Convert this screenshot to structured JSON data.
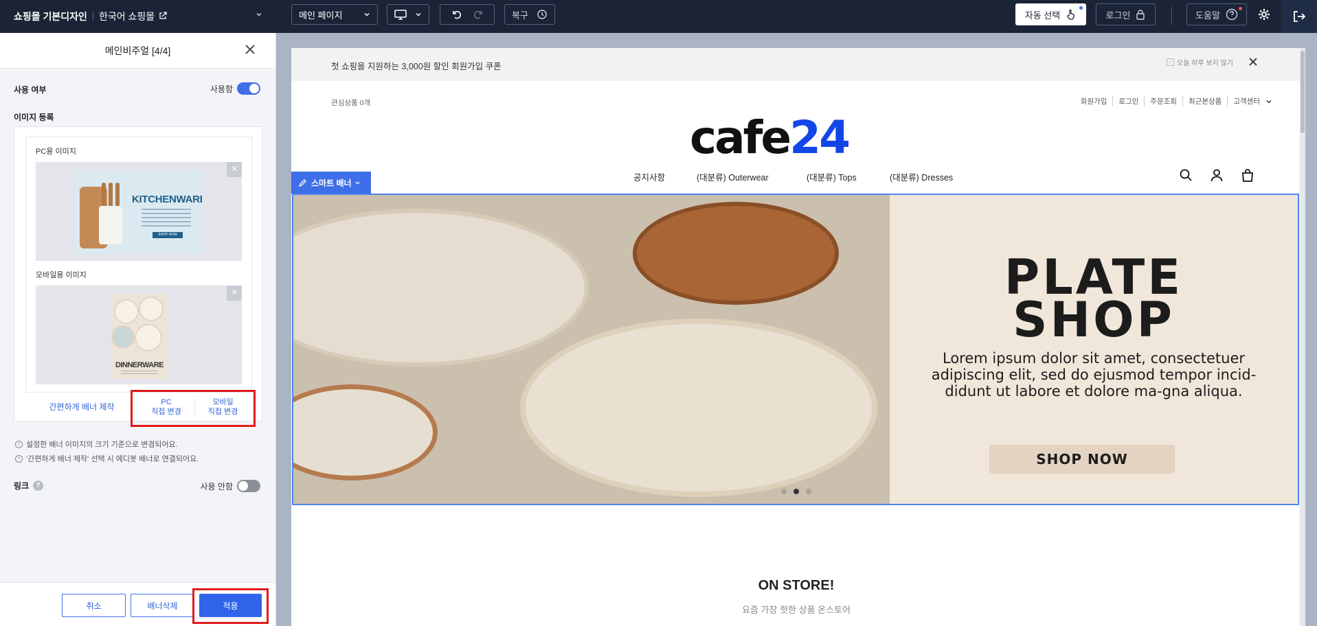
{
  "topbar": {
    "shop_name": "쇼핑몰 기본디자인",
    "language": "한국어 쇼핑몰",
    "page_select": "메인 페이지",
    "restore_label": "복구",
    "auto_select_label": "자동 선택",
    "login_label": "로그인",
    "help_label": "도움말"
  },
  "panel": {
    "title": "메인비주얼 [4/4]",
    "use_label": "사용 여부",
    "use_state": "사용함",
    "image_reg_label": "이미지 등록",
    "pc_image_label": "PC용 이미지",
    "mobile_image_label": "모바일용 이미지",
    "pc_thumb_title": "KITCHENWARE",
    "pc_thumb_button": "SHOP NOW",
    "mobile_thumb_title": "DINNERWARE",
    "easy_banner_label": "간편하게 배너 제작",
    "pc_direct_line1": "PC",
    "pc_direct_line2": "직접 변경",
    "mobile_direct_line1": "모바일",
    "mobile_direct_line2": "직접 변경",
    "note1": "설정한 배너 이미지의 크기 기준으로 변경되어요.",
    "note2": "'간편하게 배너 제작' 선택 시 에디봇 배너로 연결되어요.",
    "link_label": "링크",
    "link_state": "사용 안함",
    "cancel_label": "취소",
    "delete_label": "배너삭제",
    "apply_label": "적용"
  },
  "preview": {
    "notice_text": "첫 쇼핑을 지원하는 3,000원 할인 회원가입 쿠폰",
    "notice_check": "오늘 하루 보지 않기",
    "interest": "관심상품 0개",
    "top_links": [
      "회원가입",
      "로그인",
      "주문조회",
      "최근본상품",
      "고객센터"
    ],
    "logo_a": "cafe",
    "logo_b": "24",
    "smart_banner": "스마트 배너",
    "gnb": [
      "공지사항",
      "(대분류) Outerwear",
      "(대분류) Tops",
      "(대분류) Dresses"
    ],
    "hero_title_line1": "PLATE",
    "hero_title_line2": "SHOP",
    "hero_desc": "Lorem ipsum dolor sit amet, consectetuer adipiscing elit, sed do ejusmod tempor incid-didunt ut labore et dolore ma-gna aliqua.",
    "hero_button": "SHOP NOW",
    "section_title": "ON STORE!",
    "section_sub": "요즘 가장 핫한 상품 온스토어"
  },
  "colors": {
    "topbar_bg": "#1b2436",
    "accent": "#3e6fe8",
    "highlight_red": "#e01b1b",
    "logo_blue": "#1446e6"
  }
}
